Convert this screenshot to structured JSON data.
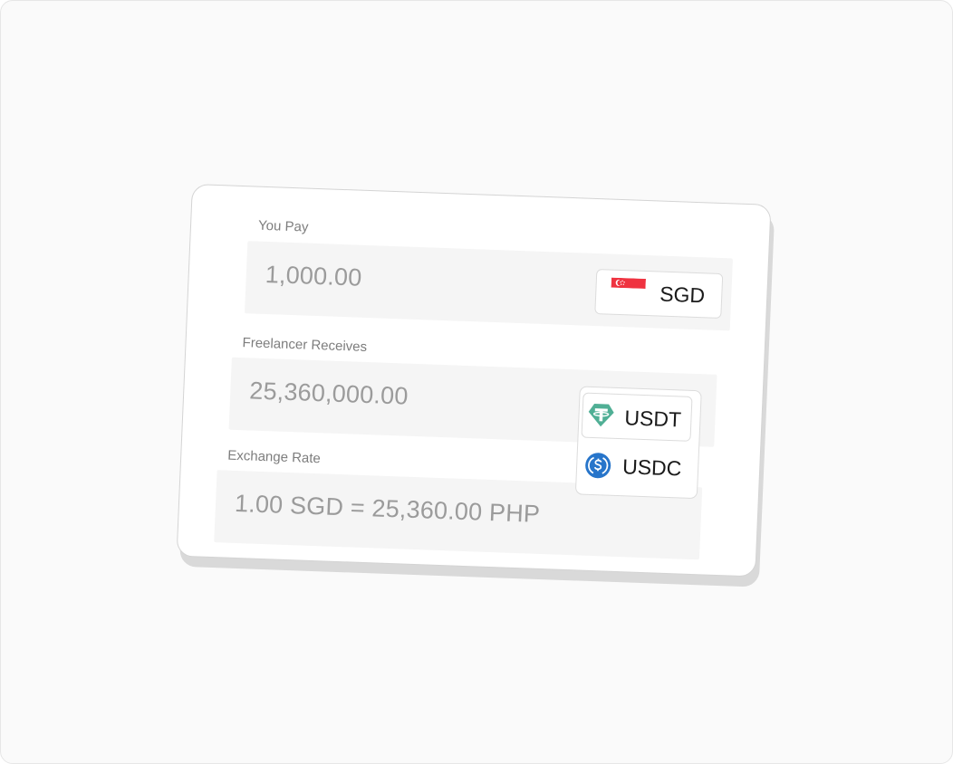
{
  "pay": {
    "label": "You Pay",
    "amount": "1,000.00",
    "currency": {
      "code": "SGD",
      "icon": "singapore-flag-icon"
    }
  },
  "receive": {
    "label": "Freelancer Receives",
    "amount": "25,360,000.00",
    "options": [
      {
        "code": "USDT",
        "icon": "tether-icon"
      },
      {
        "code": "USDC",
        "icon": "usdc-icon"
      }
    ]
  },
  "rate": {
    "label": "Exchange Rate",
    "value": "1.00 SGD = 25,360.00 PHP"
  },
  "colors": {
    "flag_red": "#EF3340",
    "tether_green": "#50AF95",
    "usdc_blue": "#2775CA"
  }
}
